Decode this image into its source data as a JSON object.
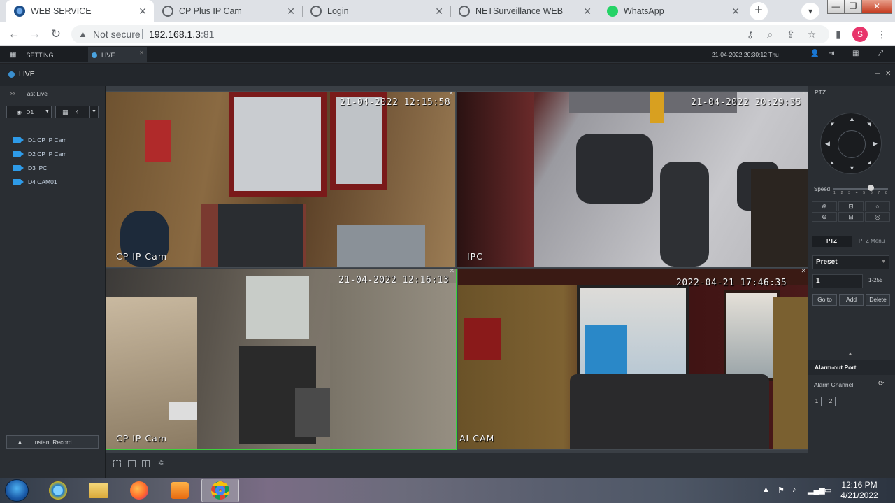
{
  "browser": {
    "tabs": [
      {
        "title": "WEB SERVICE",
        "active": true
      },
      {
        "title": "CP Plus IP Cam",
        "active": false
      },
      {
        "title": "Login",
        "active": false
      },
      {
        "title": "NETSurveillance WEB",
        "active": false
      },
      {
        "title": "WhatsApp",
        "active": false
      }
    ],
    "new_tab_glyph": "+",
    "security_label": "Not secure",
    "url_host": "192.168.1.3",
    "url_port": ":81",
    "profile_initial": "S",
    "window_controls": {
      "minimize": "—",
      "maximize": "❐",
      "close": "✕"
    }
  },
  "app": {
    "tabs": [
      {
        "label": "SETTING",
        "icon": "grid-icon"
      },
      {
        "label": "LIVE",
        "icon": "live-dot-icon"
      }
    ],
    "datetime": "21-04-2022 20:30:12 Thu",
    "live_title": "LIVE",
    "window_min": "–",
    "window_close": "✕"
  },
  "left_panel": {
    "fast_live": "Fast Live",
    "device_select": "D1",
    "split_select": "4",
    "devices": [
      "D1 CP IP Cam",
      "D2 CP IP Cam",
      "D3 IPC",
      "D4 CAM01"
    ],
    "instant_record": "Instant Record"
  },
  "channels": [
    {
      "name": "CP IP Cam",
      "timestamp": "21-04-2022 12:15:58",
      "selected": false
    },
    {
      "name": "IPC",
      "timestamp": "21-04-2022 20:29:35",
      "selected": false
    },
    {
      "name": "CP IP Cam",
      "timestamp": "21-04-2022 12:16:13",
      "selected": true
    },
    {
      "name": "AI CAM",
      "timestamp": "2022-04-21  17:46:35",
      "selected": false
    }
  ],
  "ptz": {
    "header": "PTZ",
    "speed_label": "Speed",
    "speed_ticks": [
      "1",
      "2",
      "3",
      "4",
      "5",
      "6",
      "7",
      "8"
    ],
    "speed_value": 6,
    "tab_ptz": "PTZ",
    "tab_menu": "PTZ Menu",
    "preset_select": "Preset",
    "preset_value": "1",
    "preset_range": "1-255",
    "go_to": "Go to",
    "add": "Add",
    "delete": "Delete",
    "alarm_out": "Alarm-out Port",
    "alarm_channel": "Alarm Channel",
    "alarm_ports": [
      "1",
      "2"
    ]
  },
  "taskbar": {
    "time": "12:16 PM",
    "date": "4/21/2022",
    "apps": [
      "internet-explorer-icon",
      "file-explorer-icon",
      "firefox-icon",
      "media-player-icon",
      "chrome-icon"
    ]
  },
  "colors": {
    "selected_border": "#3dd13d",
    "device_icon": "#2e9be8",
    "profile_avatar": "#e8356b"
  }
}
